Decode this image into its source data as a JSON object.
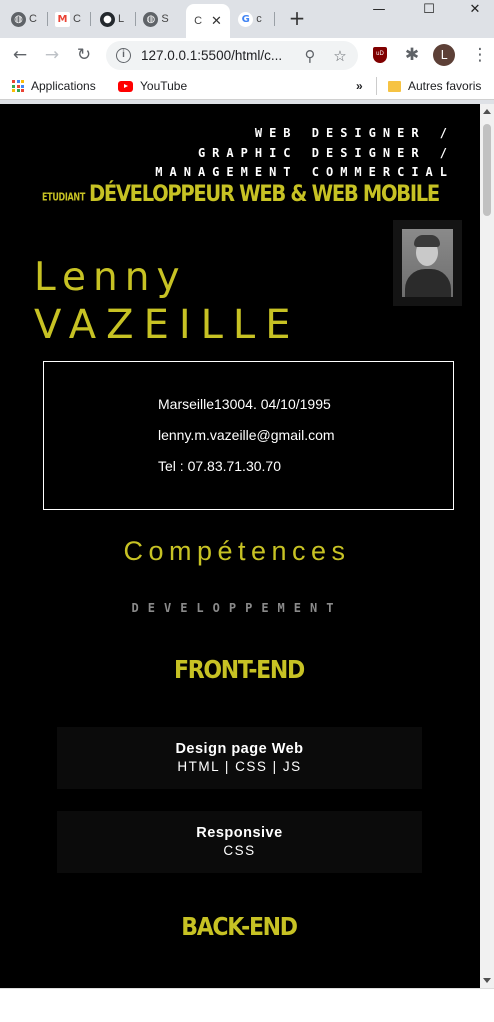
{
  "browser": {
    "tabs": [
      {
        "icon": "globe-icon",
        "title": "C",
        "color": "#5f6368"
      },
      {
        "icon": "gmail-icon",
        "title": "C",
        "color": "#ea4335"
      },
      {
        "icon": "github-icon",
        "title": "L",
        "color": "#24292e"
      },
      {
        "icon": "globe-icon",
        "title": "S",
        "color": "#5f6368"
      },
      {
        "icon": "active-page-icon",
        "title": "C",
        "color": "#ffffff"
      },
      {
        "icon": "google-icon",
        "title": "c",
        "color": "#4285f4"
      }
    ],
    "url": "127.0.0.1:5500/html/c...",
    "profile_initial": "L",
    "extension_label": "uD",
    "bookmarks": {
      "apps": "Applications",
      "youtube": "YouTube",
      "more": "»",
      "other": "Autres favoris"
    }
  },
  "cv": {
    "roles": [
      "WEB DESIGNER /",
      "GRAPHIC DESIGNER /",
      "MANAGEMENT COMMERCIAL"
    ],
    "student_label": "ETUDIANT",
    "job_title": "DÉVELOPPEUR WEB & WEB MOBILE",
    "first_name": "Lenny",
    "last_name": "VAZEILLE",
    "contact": {
      "birth": "Marseille13004. 04/10/1995",
      "email": "lenny.m.vazeille@gmail.com",
      "phone": "Tel : 07.83.71.30.70"
    },
    "skills_title": "Compétences",
    "dev_label": "DEVELOPPEMENT",
    "front_title": "FRONT-END",
    "front_skills": [
      {
        "name": "Design page Web",
        "tech": "HTML | CSS | JS"
      },
      {
        "name": "Responsive",
        "tech": "CSS"
      }
    ],
    "back_title": "BACK-END"
  },
  "colors": {
    "accent": "#c7c224",
    "background": "#000000",
    "card": "#0b0b0b"
  }
}
